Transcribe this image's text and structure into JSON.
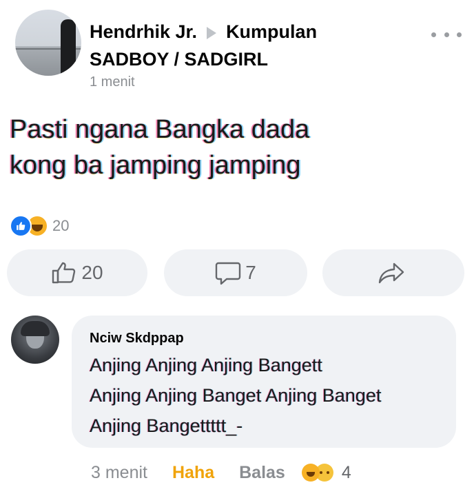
{
  "post": {
    "author": "Hendrhik Jr.",
    "group": "Kumpulan SADBOY / SADGIRL",
    "time": "1 menit",
    "text_line1": "Pasti ngana Bangka dada",
    "text_line2": "kong ba jamping jamping",
    "reaction_count": "20"
  },
  "actions": {
    "like_count": "20",
    "comment_count": "7"
  },
  "comment": {
    "name": "Nciw Skdppap",
    "line1": "Anjing Anjing Anjing Bangett",
    "line2": "Anjing Anjing Banget Anjing Banget",
    "line3": "Anjing Bangettttt_-",
    "time": "3 menit",
    "haha_label": "Haha",
    "reply_label": "Balas",
    "reaction_count": "4"
  },
  "colors": {
    "like_blue": "#1877f2",
    "haha_yellow": "#f7b125",
    "haha_text": "#f0a30a",
    "bubble_bg": "#f0f2f5",
    "secondary_text": "#8a8d91"
  },
  "icons": {
    "arrow": "arrow-right-icon",
    "more": "more-icon",
    "like": "thumbs-up-icon",
    "comment": "comment-icon",
    "share": "share-icon"
  }
}
